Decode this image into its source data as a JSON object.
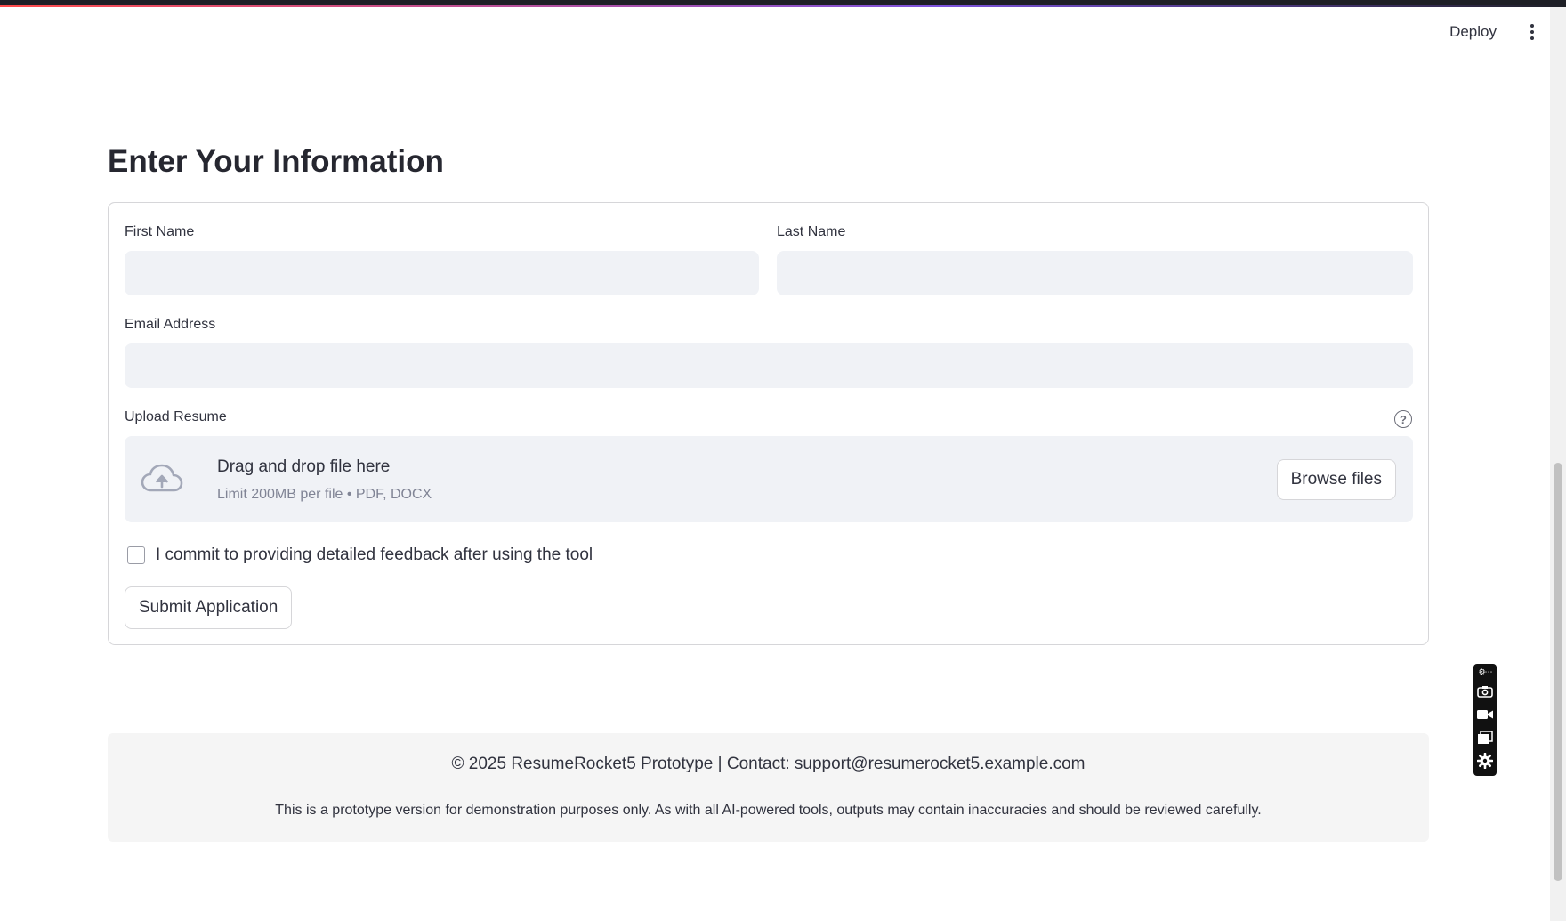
{
  "header": {
    "deploy_label": "Deploy",
    "menu_icon": "kebab-menu-icon"
  },
  "page": {
    "title": "Enter Your Information"
  },
  "form": {
    "first_name": {
      "label": "First Name",
      "value": ""
    },
    "last_name": {
      "label": "Last Name",
      "value": ""
    },
    "email": {
      "label": "Email Address",
      "value": ""
    },
    "upload": {
      "label": "Upload Resume",
      "help_icon": "question-circle-icon",
      "help_glyph": "?",
      "drop_text": "Drag and drop file here",
      "limit_text": "Limit 200MB per file • PDF, DOCX",
      "browse_label": "Browse files",
      "icon": "cloud-upload-icon"
    },
    "commit_checkbox": {
      "label": "I commit to providing detailed feedback after using the tool",
      "checked": false
    },
    "submit_label": "Submit Application"
  },
  "footer": {
    "contact": "© 2025 ResumeRocket5 Prototype | Contact: support@resumerocket5.example.com",
    "disclaimer": "This is a prototype version for demonstration purposes only. As with all AI-powered tools, outputs may contain inaccuracies and should be reviewed carefully."
  },
  "recorder_toolbar": {
    "top_glyph": "⚙⋯",
    "icons": [
      "camera-icon",
      "video-icon",
      "window-icon",
      "settings-gear-icon"
    ]
  },
  "colors": {
    "input_bg": "#f0f2f6",
    "border": "#d6d6d9",
    "text": "#31333f",
    "muted": "#808495",
    "footer_bg": "#f5f5f5",
    "accent_gradient_start": "#ff4b4b"
  }
}
